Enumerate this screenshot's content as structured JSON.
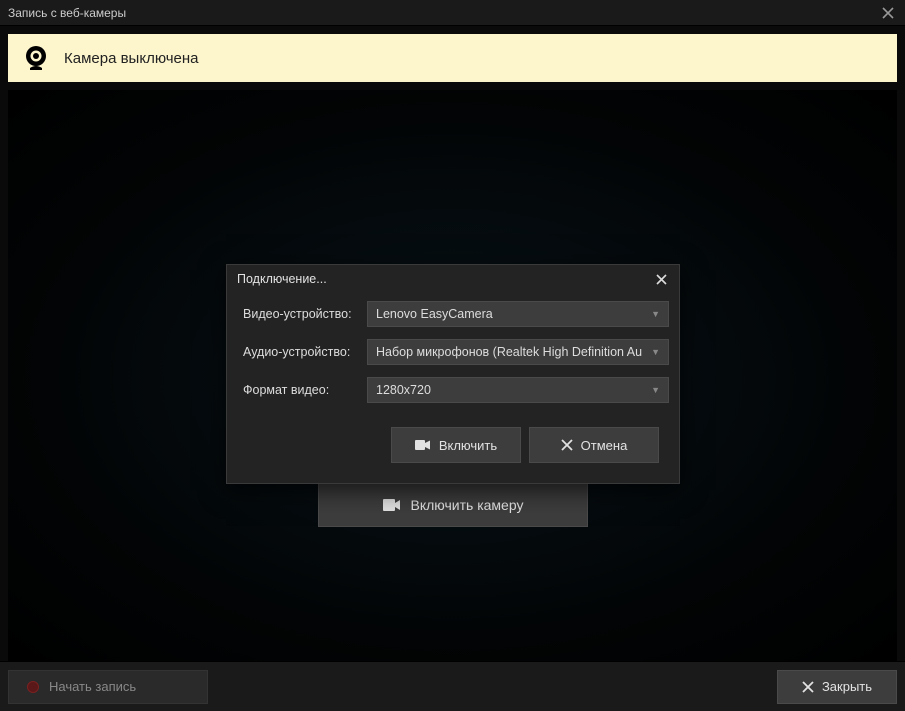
{
  "window": {
    "title": "Запись с веб-камеры"
  },
  "banner": {
    "text": "Камера выключена"
  },
  "dialog": {
    "title": "Подключение...",
    "labels": {
      "video_device": "Видео-устройство:",
      "audio_device": "Аудио-устройство:",
      "video_format": "Формат видео:"
    },
    "values": {
      "video_device": "Lenovo EasyCamera",
      "audio_device": "Набор микрофонов (Realtek High Definition Au",
      "video_format": "1280x720"
    },
    "buttons": {
      "enable": "Включить",
      "cancel": "Отмена"
    }
  },
  "main": {
    "enable_camera": "Включить камеру"
  },
  "footer": {
    "record": "Начать запись",
    "close": "Закрыть"
  }
}
